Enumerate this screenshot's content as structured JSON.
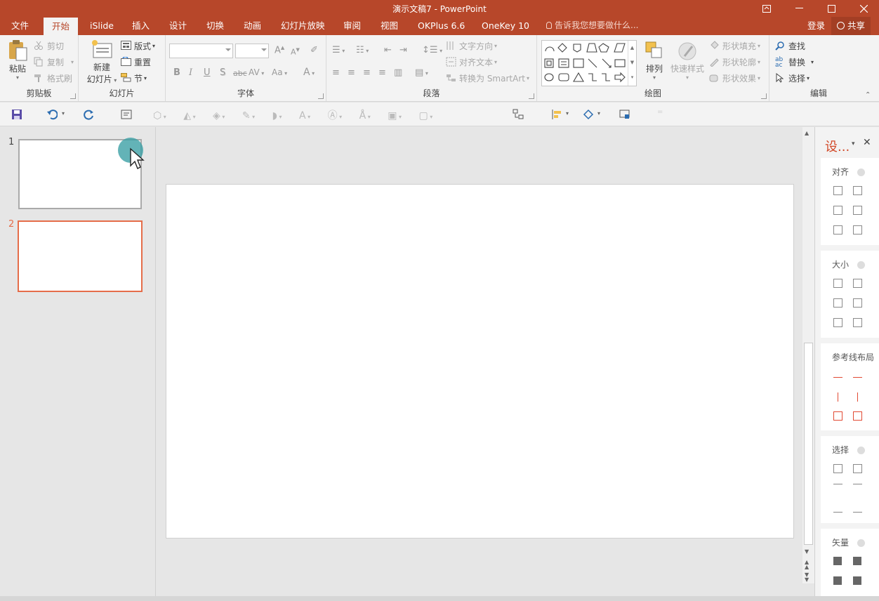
{
  "window": {
    "title": "演示文稿7 - PowerPoint"
  },
  "tabs": [
    "文件",
    "开始",
    "iSlide",
    "插入",
    "设计",
    "切换",
    "动画",
    "幻灯片放映",
    "审阅",
    "视图",
    "OKPlus 6.6",
    "OneKey 10"
  ],
  "tell_me": "告诉我您想要做什么...",
  "account": {
    "login": "登录",
    "share": "共享"
  },
  "ribbon": {
    "clipboard": {
      "label": "剪贴板",
      "paste": "粘贴",
      "cut": "剪切",
      "copy": "复制",
      "format_painter": "格式刷"
    },
    "slides": {
      "label": "幻灯片",
      "new_slide_line1": "新建",
      "new_slide_line2": "幻灯片",
      "layout": "版式",
      "reset": "重置",
      "section": "节"
    },
    "font": {
      "label": "字体",
      "bold": "B",
      "italic": "I",
      "underline": "U",
      "shadow": "S",
      "strike": "abc",
      "spacing": "AV",
      "case": "Aa",
      "color": "A",
      "grow": "A",
      "shrink": "A"
    },
    "paragraph": {
      "label": "段落",
      "text_direction": "文字方向",
      "align_text": "对齐文本",
      "convert_smartart": "转换为 SmartArt"
    },
    "drawing": {
      "label": "绘图",
      "arrange": "排列",
      "quick_styles": "快速样式",
      "shape_fill": "形状填充",
      "shape_outline": "形状轮廓",
      "shape_effects": "形状效果"
    },
    "editing": {
      "label": "编辑",
      "find": "查找",
      "replace": "替换",
      "select": "选择"
    }
  },
  "slides": [
    {
      "number": "1"
    },
    {
      "number": "2"
    }
  ],
  "selected_slide": "2",
  "panel": {
    "title": "设...",
    "sections": [
      "对齐",
      "大小",
      "参考线布局",
      "选择",
      "矢量"
    ]
  },
  "colors": {
    "accent": "#b7472a",
    "selection": "#e56d4a",
    "panel_red": "#d24726"
  }
}
